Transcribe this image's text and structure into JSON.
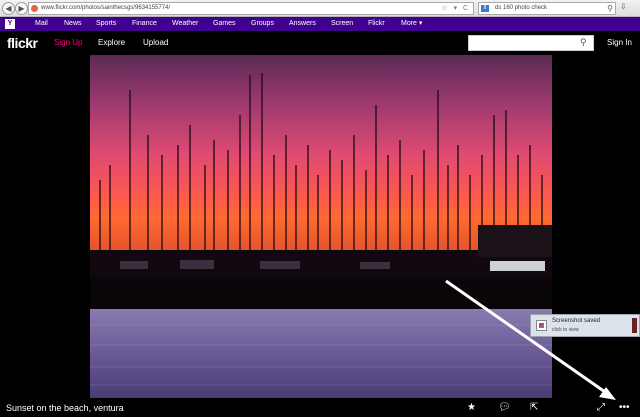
{
  "browser": {
    "url": "www.flickr.com/photos/sainthecsgs/9634155774/",
    "search_engine_label": "8",
    "search_text": "ds 160 photo check"
  },
  "yahoo_menu": {
    "logo": "Y",
    "items": [
      "Mail",
      "News",
      "Sports",
      "Finance",
      "Weather",
      "Games",
      "Groups",
      "Answers",
      "Screen",
      "Flickr",
      "More ▾"
    ]
  },
  "flickr": {
    "logo": "flickr",
    "signup_label": "Sign Up",
    "explore_label": "Explore",
    "upload_label": "Upload",
    "search_value": "",
    "signin_label": "Sign In"
  },
  "toast": {
    "title": "Screenshot saved",
    "subtitle": "click to view"
  },
  "photo": {
    "caption": "Sunset on the beach, ventura"
  },
  "icons": {
    "favorite": "star-icon",
    "comment": "speech-bubble-icon",
    "share": "share-icon",
    "fullscreen": "expand-icon",
    "more": "more-icon"
  },
  "colors": {
    "menu_purple": "#400090",
    "signup_pink": "#ff0084",
    "arrow": "#ffffff"
  }
}
